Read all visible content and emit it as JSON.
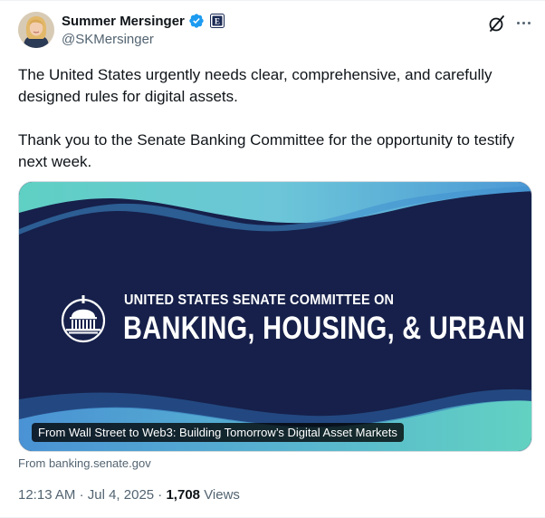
{
  "author": {
    "display_name": "Summer Mersinger",
    "handle": "@SKMersinger"
  },
  "tweet": {
    "paragraphs": [
      "The United States urgently needs clear, comprehensive, and carefully designed rules for digital assets.",
      "Thank you to the Senate Banking Committee for the opportunity to testify next week."
    ]
  },
  "card": {
    "subtitle": "UNITED STATES SENATE COMMITTEE ON",
    "title": "BANKING, HOUSING, & URBAN AFFAIRS",
    "caption": "From Wall Street to Web3: Building Tomorrow’s Digital Asset Markets",
    "source": "From banking.senate.gov"
  },
  "meta": {
    "time": "12:13 AM",
    "separator": "·",
    "date": "Jul 4, 2025",
    "views_count": "1,708",
    "views_label": "Views"
  },
  "colors": {
    "verified_blue": "#1d9bf0",
    "card_navy": "#16204a",
    "card_teal": "#5ccac4",
    "card_blue": "#4f9fd8"
  },
  "icons": {
    "verified": "verified-badge-icon",
    "affiliation": "affiliation-badge-icon",
    "grok": "grok-icon",
    "more": "more-options-icon",
    "seal": "capitol-seal-icon"
  }
}
